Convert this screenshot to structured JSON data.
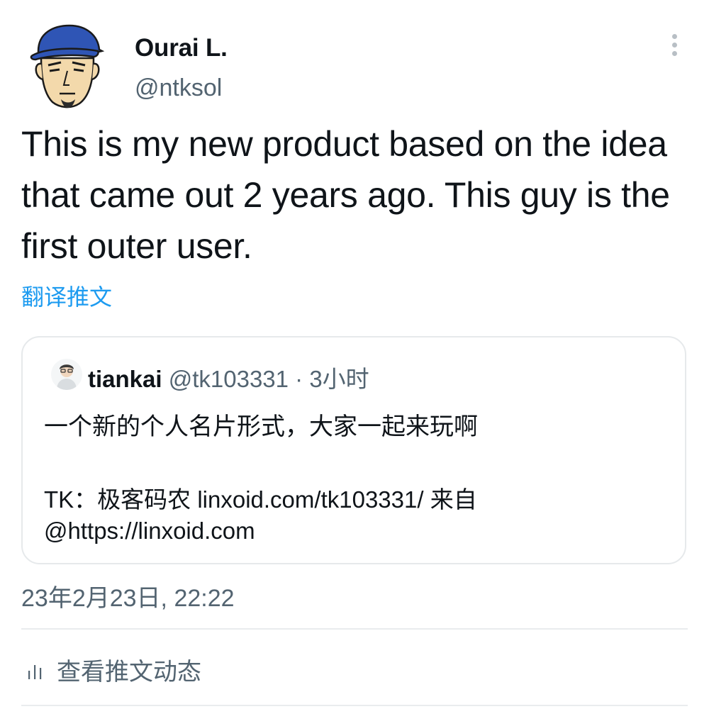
{
  "author": {
    "display_name": "Ourai L.",
    "handle": "@ntksol"
  },
  "tweet": {
    "text": "This is my new product based on the idea that came out 2 years ago. This guy is the first outer user.",
    "translate_label": "翻译推文",
    "timestamp": "23年2月23日, 22:22"
  },
  "quote": {
    "name": "tiankai",
    "meta": "@tk103331 · 3小时",
    "line1": "一个新的个人名片形式，大家一起来玩啊",
    "line2": "TK：极客码农 linxoid.com/tk103331/ 来自",
    "line3": "@https://linxoid.com"
  },
  "activity": {
    "label": "查看推文动态"
  },
  "icons": {
    "more": "more-vertical-icon",
    "activity": "bar-chart-icon"
  },
  "colors": {
    "link": "#1d9bf0",
    "secondary_text": "#536471",
    "border": "#e6e9eb"
  }
}
